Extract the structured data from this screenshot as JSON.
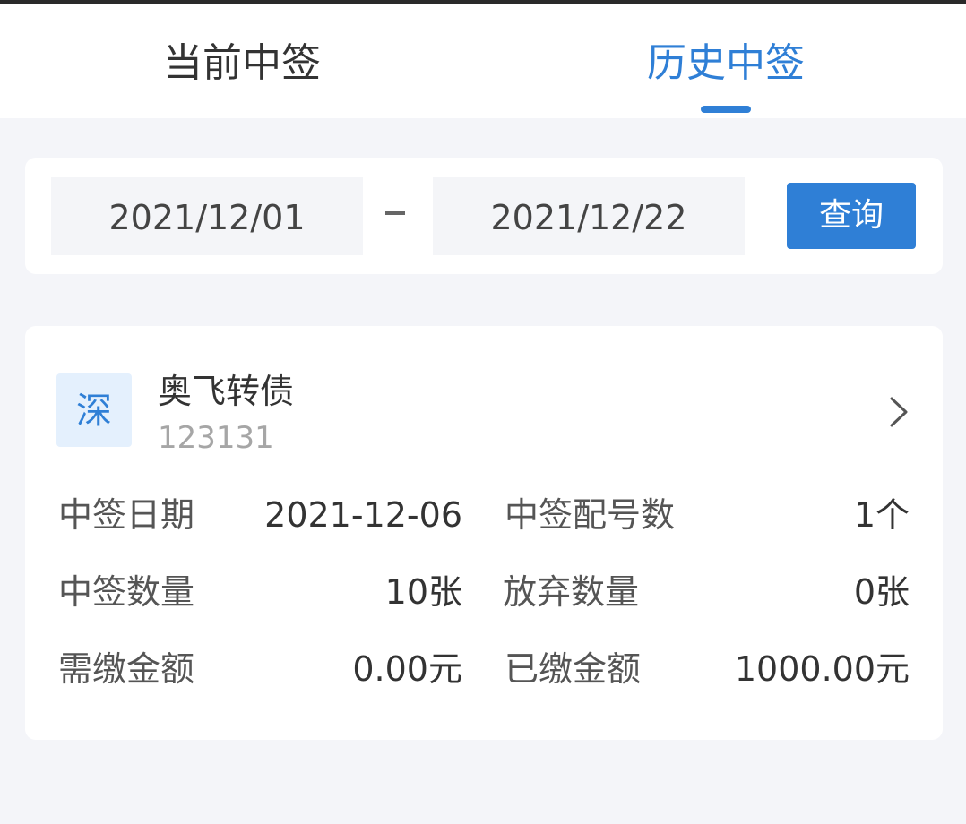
{
  "tabs": {
    "current": "当前中签",
    "history": "历史中签"
  },
  "query": {
    "start_date": "2021/12/01",
    "separator": "–",
    "end_date": "2021/12/22",
    "button_label": "查询"
  },
  "result": {
    "market_badge": "深",
    "bond_name": "奥飞转债",
    "bond_code": "123131",
    "chevron_icon": "chevron-right-icon",
    "rows": [
      {
        "label": "中签日期",
        "value": "2021-12-06"
      },
      {
        "label": "中签配号数",
        "value": "1个"
      },
      {
        "label": "中签数量",
        "value": "10张"
      },
      {
        "label": "放弃数量",
        "value": "0张"
      },
      {
        "label": "需缴金额",
        "value": "0.00元"
      },
      {
        "label": "已缴金额",
        "value": "1000.00元"
      }
    ]
  },
  "colors": {
    "accent": "#2f7fd6",
    "page_bg": "#f4f5f9",
    "badge_bg": "#e4f0fd"
  }
}
